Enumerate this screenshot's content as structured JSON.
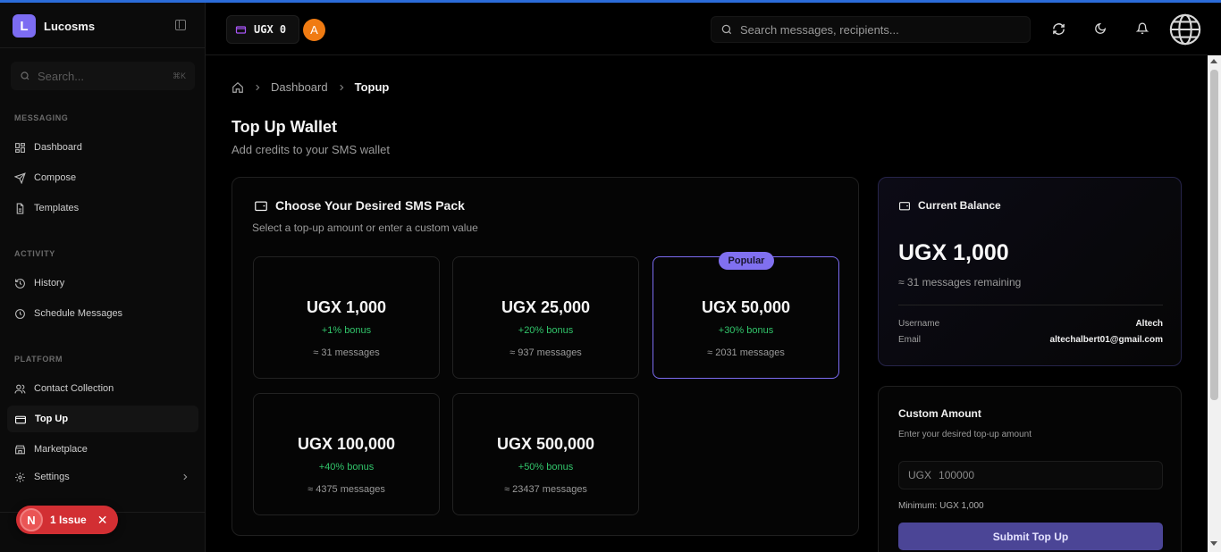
{
  "app": {
    "name": "Lucosms",
    "logo_letter": "L"
  },
  "sidebar": {
    "search_placeholder": "Search...",
    "search_shortcut": "⌘K",
    "sections": [
      {
        "label": "MESSAGING",
        "items": [
          {
            "label": "Dashboard",
            "icon": "grid-icon"
          },
          {
            "label": "Compose",
            "icon": "send-icon"
          },
          {
            "label": "Templates",
            "icon": "file-icon"
          }
        ]
      },
      {
        "label": "ACTIVITY",
        "items": [
          {
            "label": "History",
            "icon": "history-icon"
          },
          {
            "label": "Schedule Messages",
            "icon": "clock-icon"
          }
        ]
      },
      {
        "label": "PLATFORM",
        "items": [
          {
            "label": "Contact Collection",
            "icon": "users-icon"
          },
          {
            "label": "Top Up",
            "icon": "wallet-icon",
            "active": true
          },
          {
            "label": "Marketplace",
            "icon": "store-icon"
          },
          {
            "label": "Settings",
            "icon": "gear-icon"
          }
        ]
      }
    ]
  },
  "issue_toast": {
    "letter": "N",
    "label": "1 Issue"
  },
  "topbar": {
    "wallet_amount": "UGX 0",
    "avatar_letter": "A",
    "search_placeholder": "Search messages, recipients..."
  },
  "breadcrumb": {
    "parent": "Dashboard",
    "current": "Topup"
  },
  "page": {
    "title": "Top Up Wallet",
    "subtitle": "Add credits to your SMS wallet"
  },
  "packs_card": {
    "title": "Choose Your Desired SMS Pack",
    "subtitle": "Select a top-up amount or enter a custom value",
    "popular_label": "Popular",
    "packs": [
      {
        "amount": "UGX 1,000",
        "bonus": "+1% bonus",
        "messages": "≈ 31 messages"
      },
      {
        "amount": "UGX 25,000",
        "bonus": "+20% bonus",
        "messages": "≈ 937 messages"
      },
      {
        "amount": "UGX 50,000",
        "bonus": "+30% bonus",
        "messages": "≈ 2031 messages",
        "popular": true
      },
      {
        "amount": "UGX 100,000",
        "bonus": "+40% bonus",
        "messages": "≈ 4375 messages"
      },
      {
        "amount": "UGX 500,000",
        "bonus": "+50% bonus",
        "messages": "≈ 23437 messages"
      }
    ]
  },
  "balance": {
    "title": "Current Balance",
    "amount": "UGX 1,000",
    "remaining": "≈ 31 messages remaining",
    "username_label": "Username",
    "username": "Altech",
    "email_label": "Email",
    "email": "altechalbert01@gmail.com"
  },
  "custom": {
    "title": "Custom Amount",
    "subtitle": "Enter your desired top-up amount",
    "currency": "UGX",
    "placeholder": "100000",
    "minimum": "Minimum: UGX 1,000",
    "submit": "Submit Top Up"
  },
  "colors": {
    "accent": "#7c6cf2",
    "bonus": "#31c46a",
    "issue": "#d22f33"
  }
}
